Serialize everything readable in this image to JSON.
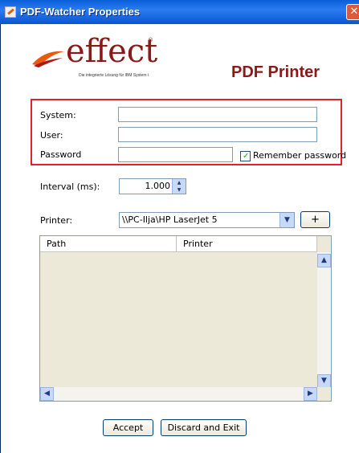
{
  "window": {
    "title": "PDF-Watcher Properties",
    "close_glyph": "✕"
  },
  "branding": {
    "logo_word": "effect",
    "logo_registered": "®",
    "logo_tagline": "Die integrierte Lösung für IBM System i",
    "product_name": "PDF Printer",
    "brand_color": "#8a1a18"
  },
  "credentials": {
    "system_label": "System:",
    "system_value": "",
    "user_label": "User:",
    "user_value": "",
    "password_label": "Password",
    "password_value": "",
    "remember_label": "Remember password",
    "remember_checked": true,
    "highlight_color": "#e0202a"
  },
  "interval": {
    "label": "Interval (ms):",
    "value": "1.000"
  },
  "printer": {
    "label": "Printer:",
    "selected": "\\\\PC-Ilja\\HP LaserJet 5",
    "add_label": "+"
  },
  "table": {
    "columns": [
      "Path",
      "Printer"
    ],
    "rows": []
  },
  "buttons": {
    "accept": "Accept",
    "discard": "Discard and Exit"
  }
}
